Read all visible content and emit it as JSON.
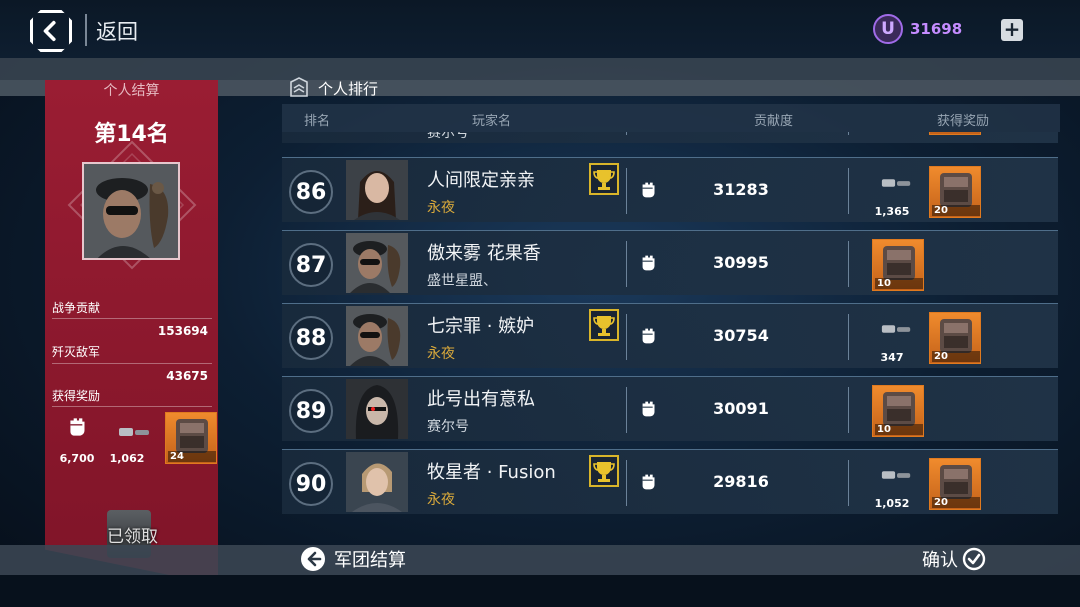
{
  "header": {
    "back_label": "返回",
    "currency_symbol": "U",
    "currency_value": "31698",
    "plus_label": "+"
  },
  "personal": {
    "title": "个人结算",
    "rank_label": "第14名",
    "war_contribution_label": "战争贡献",
    "war_contribution_value": "153694",
    "kills_label": "歼灭敌军",
    "kills_value": "43675",
    "rewards_label": "获得奖励",
    "rewards": [
      {
        "icon": "fist-icon",
        "count": "6,700"
      },
      {
        "icon": "ammo-icon",
        "count": "1,062"
      },
      {
        "icon": "crate-icon",
        "count": "24"
      }
    ],
    "claimed_label": "已领取"
  },
  "ranking": {
    "title": "个人排行",
    "columns": {
      "rank": "排名",
      "player": "玩家名",
      "contribution": "贡献度",
      "reward": "获得奖励"
    },
    "partial_guild": "赛尔号",
    "rows": [
      {
        "rank": "86",
        "name": "人间限定亲亲",
        "guild": "永夜",
        "guild_color": "#d9a93b",
        "trophy": true,
        "contribution": "31283",
        "ammo": "1,365",
        "crate": "20"
      },
      {
        "rank": "87",
        "name": "傲来雾 花果香",
        "guild": "盛世星盟、",
        "guild_color": "#cfd6dd",
        "trophy": false,
        "contribution": "30995",
        "ammo": "",
        "crate": "10"
      },
      {
        "rank": "88",
        "name": "七宗罪 · 嫉妒",
        "guild": "永夜",
        "guild_color": "#d9a93b",
        "trophy": true,
        "contribution": "30754",
        "ammo": "347",
        "crate": "20"
      },
      {
        "rank": "89",
        "name": "此号出有意私",
        "guild": "赛尔号",
        "guild_color": "#cfd6dd",
        "trophy": false,
        "contribution": "30091",
        "ammo": "",
        "crate": "10"
      },
      {
        "rank": "90",
        "name": "牧星者 · Fusion",
        "guild": "永夜",
        "guild_color": "#d9a93b",
        "trophy": true,
        "contribution": "29816",
        "ammo": "1,052",
        "crate": "20"
      }
    ]
  },
  "footer": {
    "legion_label": "军团结算",
    "confirm_label": "确认"
  }
}
